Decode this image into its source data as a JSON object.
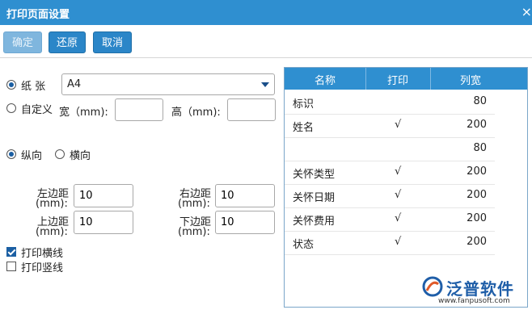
{
  "window": {
    "title": "打印页面设置",
    "close_label": "×"
  },
  "toolbar": {
    "confirm": "确定",
    "restore": "还原",
    "cancel": "取消"
  },
  "paper": {
    "paper_label": "纸 张",
    "paper_value": "A4",
    "custom_label": "自定义",
    "width_label": "宽（mm):",
    "height_label": "高（mm):",
    "width_value": "",
    "height_value": ""
  },
  "orientation": {
    "portrait": "纵向",
    "landscape": "横向",
    "selected": "portrait"
  },
  "margins": {
    "left_label_1": "左边距",
    "left_label_2": "(mm):",
    "left_value": "10",
    "right_label_1": "右边距",
    "right_label_2": "(mm):",
    "right_value": "10",
    "top_label_1": "上边距",
    "top_label_2": "(mm):",
    "top_value": "10",
    "bottom_label_1": "下边距",
    "bottom_label_2": "(mm):",
    "bottom_value": "10"
  },
  "options": {
    "print_h_lines": "打印横线",
    "print_h_checked": true,
    "print_v_lines": "打印竖线",
    "print_v_checked": false
  },
  "columns": {
    "headers": {
      "name": "名称",
      "print": "打印",
      "width": "列宽"
    },
    "rows": [
      {
        "name": "标识",
        "print": "",
        "width": "80"
      },
      {
        "name": "姓名",
        "print": "√",
        "width": "200"
      },
      {
        "name": "",
        "print": "",
        "width": "80"
      },
      {
        "name": "关怀类型",
        "print": "√",
        "width": "200"
      },
      {
        "name": "关怀日期",
        "print": "√",
        "width": "200"
      },
      {
        "name": "关怀费用",
        "print": "√",
        "width": "200"
      },
      {
        "name": "状态",
        "print": "√",
        "width": "200"
      }
    ]
  },
  "brand": {
    "name": "泛普软件",
    "url": "www.fanpusoft.com"
  },
  "colors": {
    "title_bar": "#2f8fd0",
    "button": "#2b86c8",
    "header": "#2f8fd0"
  }
}
